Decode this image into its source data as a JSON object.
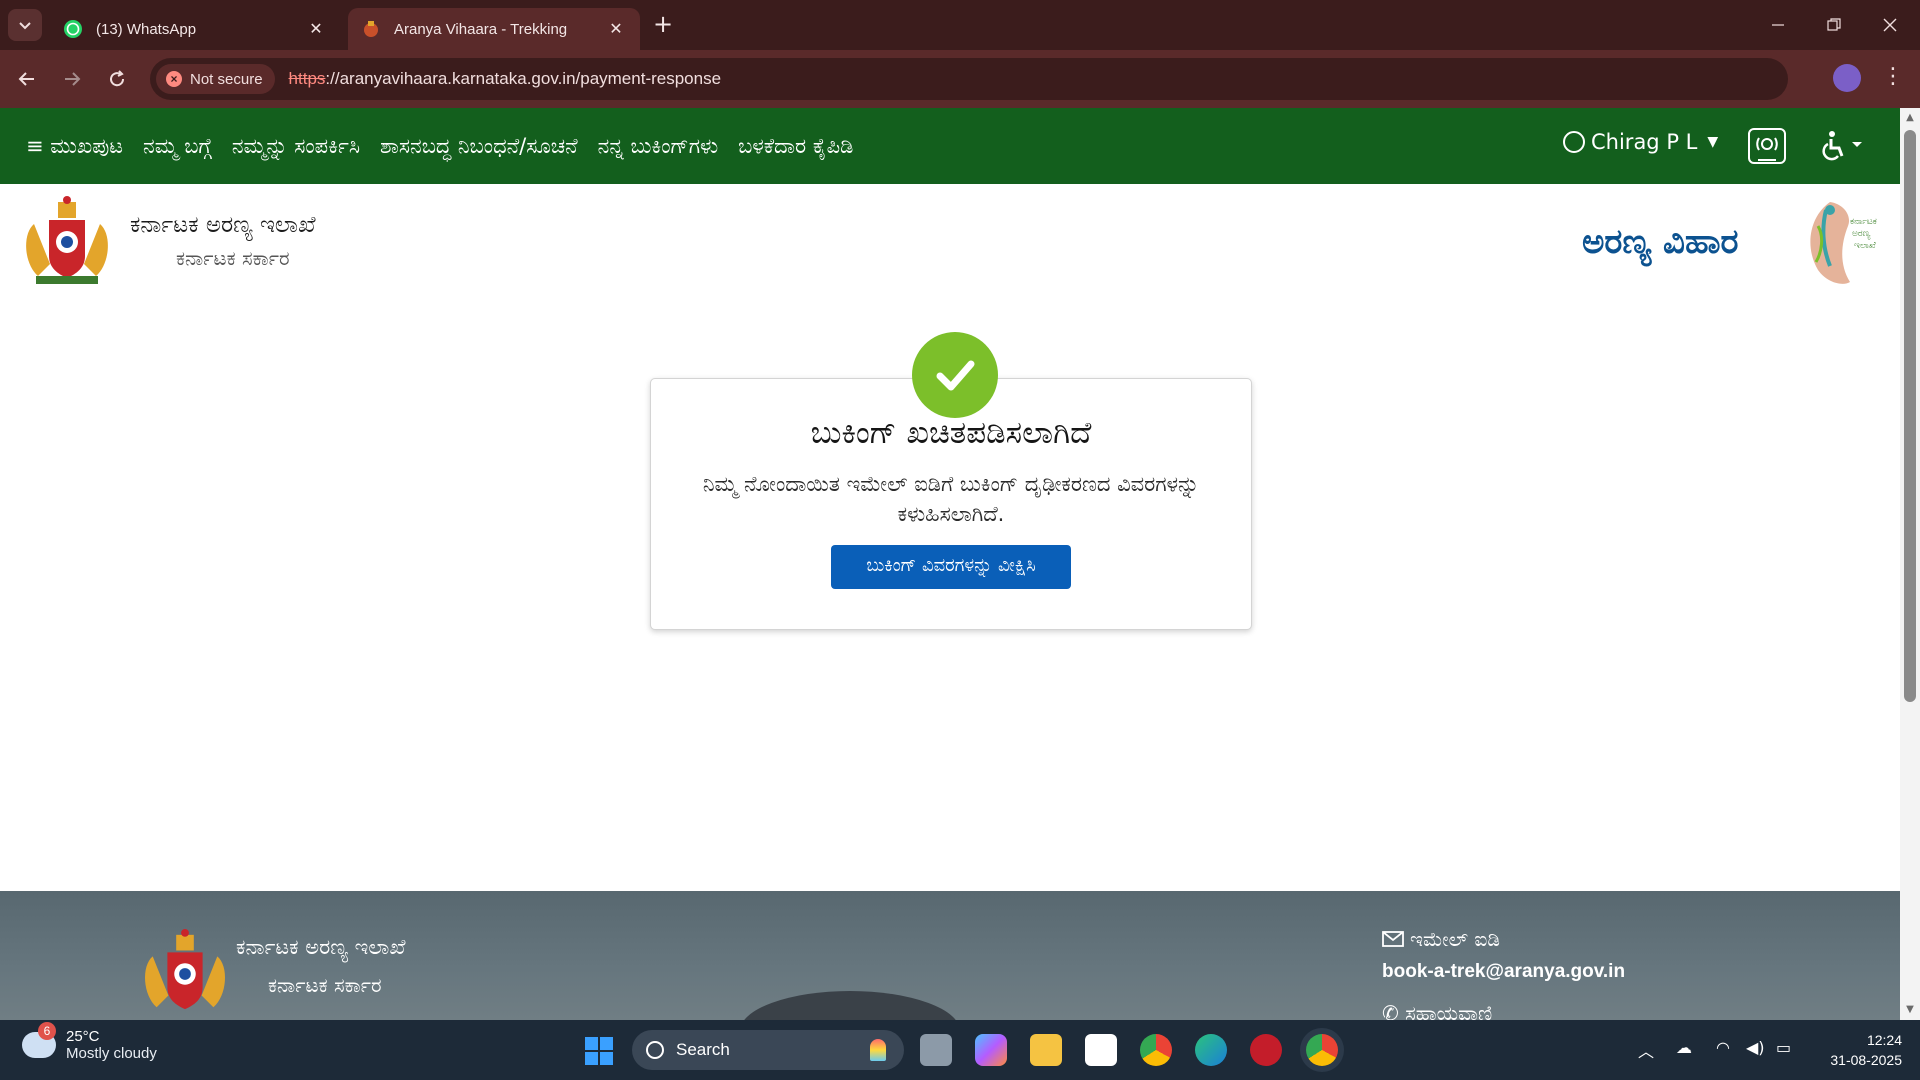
{
  "browser": {
    "tabs": [
      {
        "title": "(13) WhatsApp",
        "favicon": "whatsapp-icon",
        "active": false
      },
      {
        "title": "Aranya Vihaara - Trekking",
        "favicon": "karnataka-emblem-icon",
        "active": true
      }
    ],
    "security_label": "Not secure",
    "url_scheme": "https",
    "url_rest": "://aranyavihaara.karnataka.gov.in/payment-response"
  },
  "nav": {
    "items": [
      "ಮುಖಪುಟ",
      "ನಮ್ಮ ಬಗ್ಗೆ",
      "ನಮ್ಮನ್ನು ಸಂಪರ್ಕಿಸಿ",
      "ಶಾಸನಬದ್ಧ ನಿಬಂಧನೆ/ಸೂಚನೆ",
      "ನನ್ನ ಬುಕಿಂಗ್‌ಗಳು",
      "ಬಳಕೆದಾರ ಕೈಪಿಡಿ"
    ],
    "user_name": "Chirag P L"
  },
  "brand": {
    "dept_name": "ಕರ್ನಾಟಕ ಅರಣ್ಯ ಇಲಾಖೆ",
    "dept_sub": "ಕರ್ನಾಟಕ ಸರ್ಕಾರ",
    "site_title": "ಅರಣ್ಯ ವಿಹಾರ"
  },
  "confirmation": {
    "title": "ಬುಕಿಂಗ್ ಖಚಿತಪಡಿಸಲಾಗಿದೆ",
    "message": "ನಿಮ್ಮ ನೋಂದಾಯಿತ ಇಮೇಲ್ ಐಡಿಗೆ ಬುಕಿಂಗ್ ದೃಢೀಕರಣದ ವಿವರಗಳನ್ನು ಕಳುಹಿಸಲಾಗಿದೆ.",
    "button_label": "ಬುಕಿಂಗ್ ವಿವರಗಳನ್ನು ವೀಕ್ಷಿಸಿ",
    "accent_color": "#7cbf2a",
    "button_color": "#0a5fb8"
  },
  "footer": {
    "dept_name": "ಕರ್ನಾಟಕ ಅರಣ್ಯ ಇಲಾಖೆ",
    "dept_sub": "ಕರ್ನಾಟಕ ಸರ್ಕಾರ",
    "email_label": "ಇಮೇಲ್ ಐಡಿ",
    "email": "book-a-trek@aranya.gov.in",
    "phone_label": "ಸಹಾಯವಾಣಿ"
  },
  "taskbar": {
    "weather_badge": "6",
    "temperature": "25°C",
    "weather_text": "Mostly cloudy",
    "search_label": "Search",
    "time": "12:24",
    "date": "31-08-2025"
  },
  "colors": {
    "nav_green": "#135f1d",
    "title_blue": "#0c5290",
    "chrome_maroon": "#5a2a2a"
  }
}
